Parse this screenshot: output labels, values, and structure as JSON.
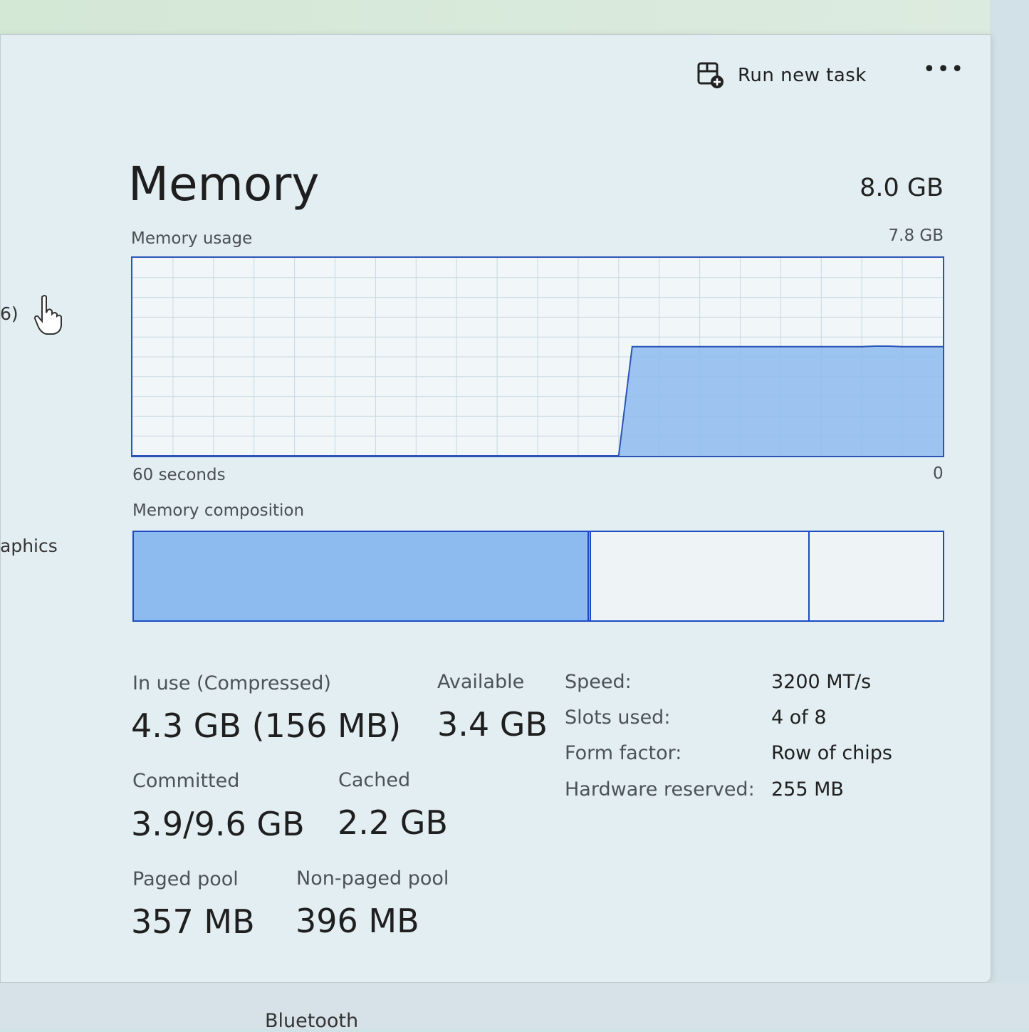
{
  "toolbar": {
    "run_new_task_label": "Run new task",
    "more_label": "•••"
  },
  "sidebar": {
    "partial_item_1": "6)",
    "partial_item_2": "aphics"
  },
  "memory": {
    "title": "Memory",
    "total": "8.0 GB",
    "usage_label": "Memory usage",
    "usage_max": "7.8 GB",
    "time_left": "60 seconds",
    "time_right": "0",
    "composition_label": "Memory composition"
  },
  "chart_data": {
    "type": "area",
    "title": "Memory usage",
    "xlabel": "",
    "ylabel": "",
    "x_range_seconds": [
      60,
      0
    ],
    "ylim": [
      0,
      7.8
    ],
    "series": [
      {
        "values_gb": [
          0,
          0,
          0,
          0,
          0,
          0,
          0,
          0,
          0,
          0,
          0,
          0,
          0,
          0,
          0,
          0,
          0,
          0,
          0,
          0,
          0,
          0,
          0,
          0,
          0,
          0,
          0,
          0,
          0,
          0,
          0,
          0,
          0,
          0,
          0,
          0,
          0,
          4.3,
          4.3,
          4.3,
          4.3,
          4.3,
          4.3,
          4.3,
          4.3,
          4.3,
          4.3,
          4.3,
          4.3,
          4.3,
          4.3,
          4.3,
          4.3,
          4.3,
          4.3,
          4.32,
          4.32,
          4.3,
          4.3,
          4.3,
          4.3
        ]
      }
    ],
    "grid": true
  },
  "composition": {
    "in_use_fraction": 0.56,
    "modified_fraction": 0.005,
    "standby_fraction": 0.27,
    "free_fraction": 0.165
  },
  "stats": {
    "in_use_label": "In use (Compressed)",
    "in_use_value": "4.3 GB (156 MB)",
    "available_label": "Available",
    "available_value": "3.4 GB",
    "committed_label": "Committed",
    "committed_value": "3.9/9.6 GB",
    "cached_label": "Cached",
    "cached_value": "2.2 GB",
    "paged_label": "Paged pool",
    "paged_value": "357 MB",
    "nonpaged_label": "Non-paged pool",
    "nonpaged_value": "396 MB"
  },
  "details": [
    {
      "key": "Speed:",
      "value": "3200 MT/s"
    },
    {
      "key": "Slots used:",
      "value": "4 of 8"
    },
    {
      "key": "Form factor:",
      "value": "Row of chips"
    },
    {
      "key": "Hardware reserved:",
      "value": "255 MB"
    }
  ],
  "bottom": {
    "bluetooth_label": "Bluetooth"
  },
  "colors": {
    "graph_line": "#2b54b8",
    "graph_fill": "#8ebbef",
    "grid": "#c9d9e2"
  }
}
